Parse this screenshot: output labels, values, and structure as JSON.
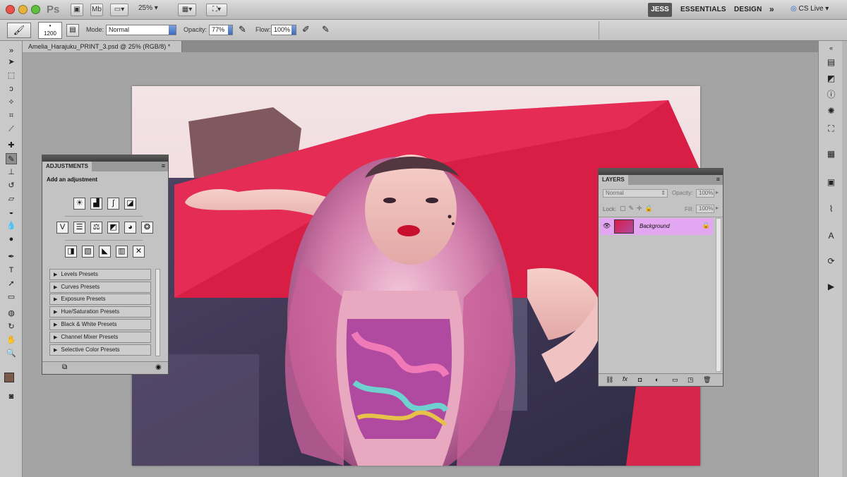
{
  "app_bar": {
    "logo": "Ps",
    "zoom_level": "25%",
    "mb_label": "Mb",
    "workspaces": {
      "active": "JESS",
      "essentials": "ESSENTIALS",
      "design": "DESIGN",
      "more": "»"
    },
    "cs_live": "CS Live ▾"
  },
  "options_bar": {
    "brush_size": "1200",
    "mode_label": "Mode:",
    "mode_value": "Normal",
    "opacity_label": "Opacity:",
    "opacity_value": "77%",
    "flow_label": "Flow:",
    "flow_value": "100%"
  },
  "document": {
    "tab_title": "Amelia_Harajuku_PRINT_3.psd @ 25% (RGB/8) *"
  },
  "adjustments_panel": {
    "tab": "ADJUSTMENTS",
    "heading": "Add an adjustment",
    "presets": [
      "Levels Presets",
      "Curves Presets",
      "Exposure Presets",
      "Hue/Saturation Presets",
      "Black & White Presets",
      "Channel Mixer Presets",
      "Selective Color Presets"
    ]
  },
  "layers_panel": {
    "tab": "LAYERS",
    "blend_mode": "Normal",
    "opacity_label": "Opacity:",
    "opacity_value": "100%",
    "lock_label": "Lock:",
    "fill_label": "Fill:",
    "fill_value": "100%",
    "layers": [
      {
        "name": "Background",
        "selected": true
      }
    ],
    "footer_fx": "fx"
  },
  "colors": {
    "accent_blue": "#3a6bbf",
    "layer_selected": "#e3a6f0",
    "foreground_swatch": "#7b5a4a",
    "background_swatch": "#ffffff"
  }
}
